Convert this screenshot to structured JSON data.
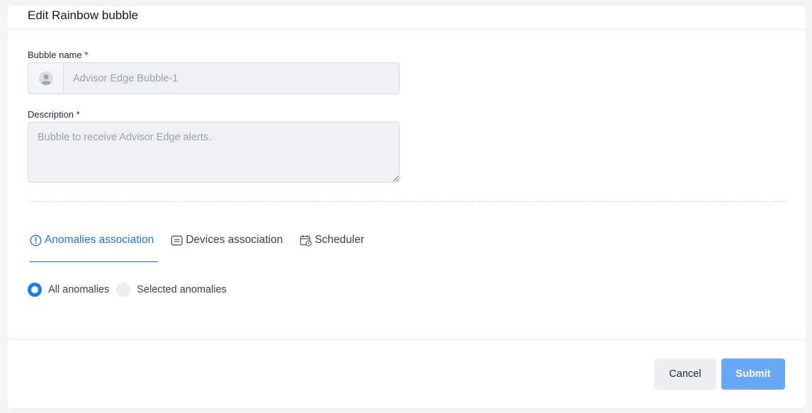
{
  "dialog": {
    "title": "Edit Rainbow bubble"
  },
  "form": {
    "name_label": "Bubble name *",
    "name_value": "Advisor Edge Bubble-1",
    "description_label": "Description *",
    "description_value": "Bubble to receive Advisor Edge alerts."
  },
  "tabs": [
    {
      "label": "Anomalies association",
      "icon": "alert-circle-icon",
      "active": true
    },
    {
      "label": "Devices association",
      "icon": "device-list-icon",
      "active": false
    },
    {
      "label": "Scheduler",
      "icon": "calendar-clock-icon",
      "active": false
    }
  ],
  "anomalies": {
    "options": [
      {
        "label": "All anomalies",
        "selected": true
      },
      {
        "label": "Selected anomalies",
        "selected": false
      }
    ]
  },
  "footer": {
    "cancel_label": "Cancel",
    "submit_label": "Submit"
  },
  "colors": {
    "accent": "#1d74d4",
    "radio_selected": "#1e7ef0",
    "submit_bg": "#6aa8f5",
    "input_bg": "#eff0f3"
  }
}
